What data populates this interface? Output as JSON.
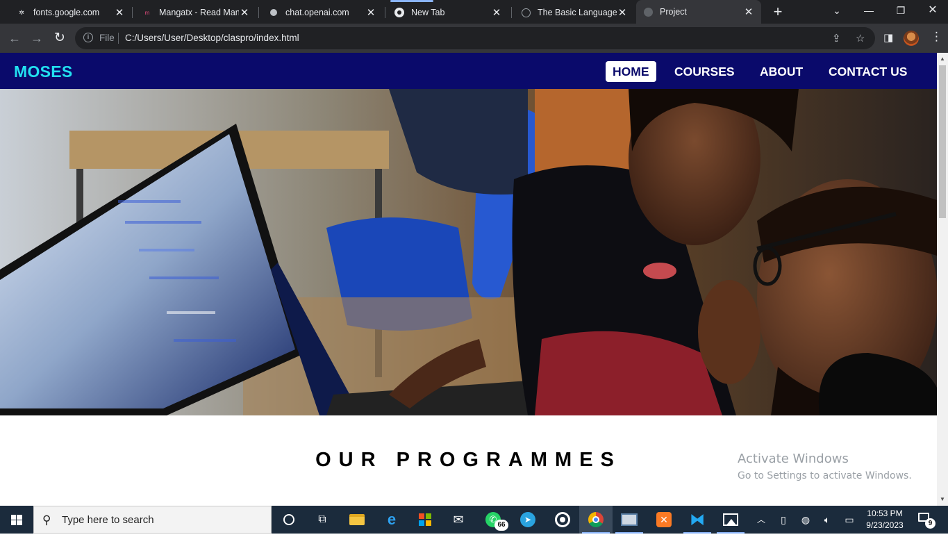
{
  "browser": {
    "tabs": [
      {
        "title": "fonts.google.com",
        "favicon": "fonts-google-icon",
        "active": false
      },
      {
        "title": "Mangatx - Read Mang",
        "favicon": "mangatx-icon",
        "active": false
      },
      {
        "title": "chat.openai.com",
        "favicon": "openai-icon",
        "active": false
      },
      {
        "title": "New Tab",
        "favicon": "chrome-icon",
        "active": false
      },
      {
        "title": "The Basic Language of",
        "favicon": "globe-icon",
        "active": false
      },
      {
        "title": "Project",
        "favicon": "globe-icon",
        "active": true
      }
    ],
    "new_tab_label": "+",
    "address_scheme_label": "File",
    "address_url": "C:/Users/User/Desktop/claspro/index.html"
  },
  "site": {
    "brand": "MOSES",
    "nav": [
      {
        "label": "HOME",
        "active": true
      },
      {
        "label": "COURSES",
        "active": false
      },
      {
        "label": "ABOUT",
        "active": false
      },
      {
        "label": "CONTACT US",
        "active": false
      }
    ],
    "hero_image": "people-at-computer-photo",
    "section_title": "OUR PROGRAMMES",
    "colors": {
      "nav_bg": "#0a0a6b",
      "brand": "#22e0f0"
    }
  },
  "watermark": {
    "line1": "Activate Windows",
    "line2": "Go to Settings to activate Windows."
  },
  "taskbar": {
    "search_placeholder": "Type here to search",
    "whatsapp_badge": "66",
    "clock_time": "10:53 PM",
    "clock_date": "9/23/2023",
    "notification_count": "9"
  }
}
